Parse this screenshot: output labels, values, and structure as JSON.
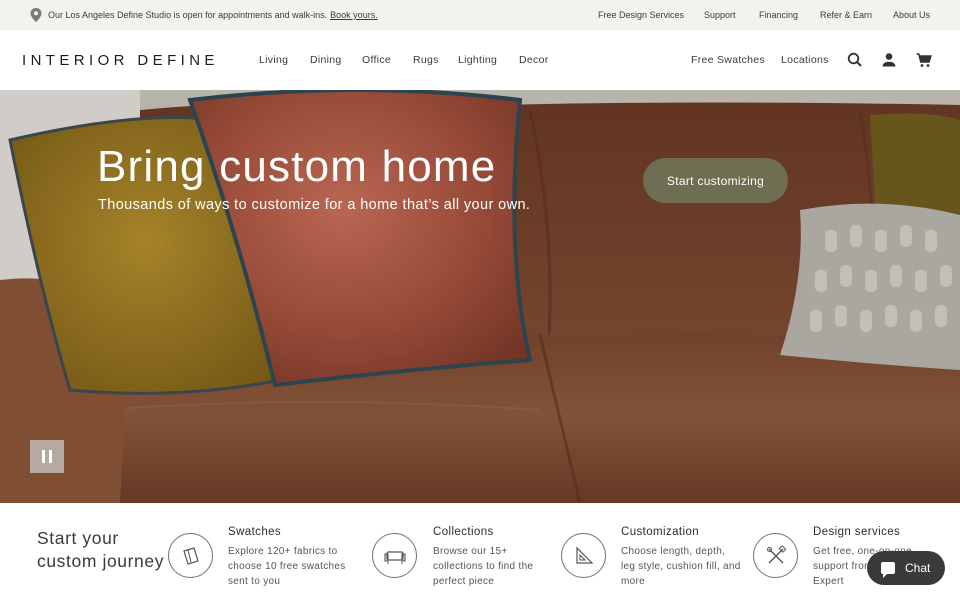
{
  "announcement": {
    "message": "Our Los Angeles Define Studio is open for appointments and walk-ins.",
    "link": "Book yours."
  },
  "utility_nav": [
    "Free Design Services",
    "Support",
    "Financing",
    "Refer & Earn",
    "About Us"
  ],
  "header": {
    "logo": "INTERIOR DEFINE",
    "nav": [
      "Living",
      "Dining",
      "Office",
      "Rugs",
      "Lighting",
      "Decor"
    ],
    "right_links": [
      "Free Swatches",
      "Locations"
    ],
    "icons": [
      "search-icon",
      "account-icon",
      "cart-icon"
    ]
  },
  "hero": {
    "title": "Bring custom home",
    "subtitle": "Thousands of ways to customize for a home that’s all your own.",
    "cta": "Start customizing"
  },
  "journey": {
    "title": "Start your custom journey",
    "items": [
      {
        "title": "Swatches",
        "text": "Explore 120+ fabrics to choose 10 free swatches sent to you",
        "icon": "swatch-icon"
      },
      {
        "title": "Collections",
        "text": "Browse our 15+ collections to find the perfect piece",
        "icon": "sofa-icon"
      },
      {
        "title": "Customization",
        "text": "Choose length, depth, leg style, cushion fill, and more",
        "icon": "ruler-icon"
      },
      {
        "title": "Design services",
        "text": "Get free, one-on-one support from a Design Expert",
        "icon": "tools-icon"
      }
    ]
  },
  "chat": {
    "label": "Chat"
  },
  "colors": {
    "cta": "#6e6e52",
    "announcement_bg": "#f3f2ef",
    "chat": "#3a3a3a"
  }
}
